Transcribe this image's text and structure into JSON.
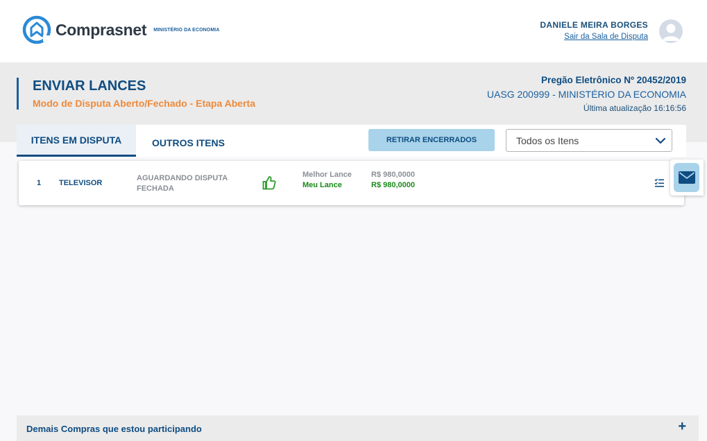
{
  "brand": {
    "name": "Comprasnet",
    "ministry": "MINISTÉRIO DA ECONOMIA",
    "primary_color": "#0f4c81",
    "accent_color": "#ee8a3a"
  },
  "user": {
    "name": "DANIELE MEIRA BORGES",
    "logout_link": "Sair da Sala de Disputa",
    "avatar_icon": "user-avatar-icon"
  },
  "page": {
    "title": "ENVIAR LANCES",
    "subtitle": "Modo de Disputa Aberto/Fechado - Etapa Aberta",
    "pregao": "Pregão Eletrônico Nº 20452/2019",
    "uasg": "UASG 200999 - MINISTÉRIO DA ECONOMIA",
    "last_update": "Última atualização 16:16:56"
  },
  "tabs": [
    {
      "label": "ITENS EM DISPUTA",
      "active": true
    },
    {
      "label": "OUTROS ITENS",
      "active": false
    }
  ],
  "toolbar": {
    "retirar_label": "RETIRAR ENCERRADOS",
    "filter_selected": "Todos os Itens"
  },
  "items": [
    {
      "number": "1",
      "name": "TELEVISOR",
      "status": "AGUARDANDO DISPUTA FECHADA",
      "status_icon": "thumbs-up-icon",
      "best_bid_label": "Melhor Lance",
      "best_bid_value": "R$ 980,0000",
      "my_bid_label": "Meu Lance",
      "my_bid_value": "R$ 980,0000"
    }
  ],
  "floating": {
    "icon": "envelope-icon"
  },
  "footer": {
    "label": "Demais Compras que estou participando",
    "expand_symbol": "+"
  }
}
